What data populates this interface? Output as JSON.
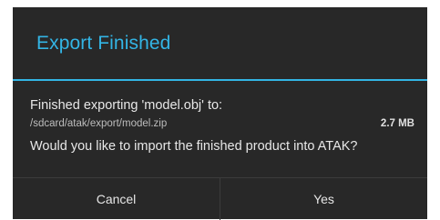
{
  "dialog": {
    "title": "Export Finished",
    "message_line1": "Finished exporting 'model.obj' to:",
    "file_path": "/sdcard/atak/export/model.zip",
    "file_size": "2.7 MB",
    "question": "Would you like to import the finished product into ATAK?",
    "buttons": {
      "cancel_label": "Cancel",
      "yes_label": "Yes"
    }
  },
  "colors": {
    "accent": "#33b5e5",
    "dialog_background": "#282828",
    "text_primary": "#e8e8e8"
  }
}
